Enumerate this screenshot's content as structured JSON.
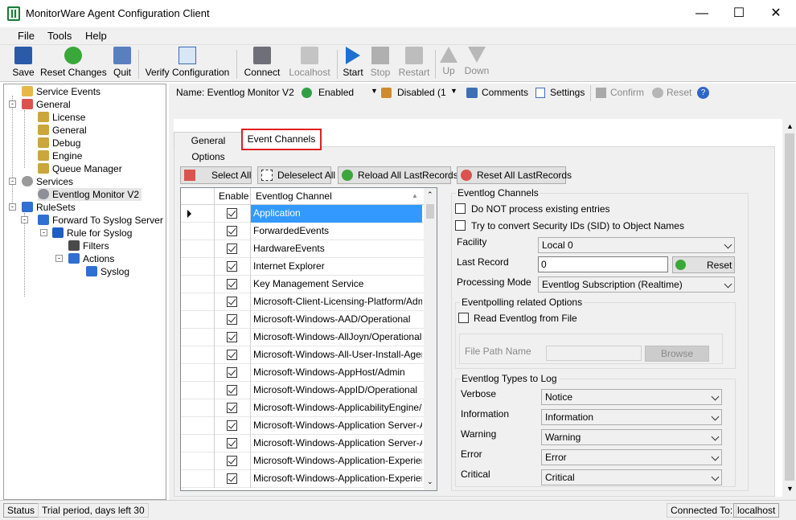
{
  "window": {
    "title": "MonitorWare Agent Configuration Client"
  },
  "menu": [
    "File",
    "Tools",
    "Help"
  ],
  "toolbar": {
    "save": "Save",
    "reset_changes": "Reset Changes",
    "quit": "Quit",
    "verify": "Verify Configuration",
    "connect": "Connect",
    "localhost": "Localhost",
    "start": "Start",
    "stop": "Stop",
    "restart": "Restart",
    "up": "Up",
    "down": "Down"
  },
  "tree": {
    "service_events": "Service Events",
    "general": "General",
    "license": "License",
    "general2": "General",
    "debug": "Debug",
    "engine": "Engine",
    "queue_manager": "Queue Manager",
    "services": "Services",
    "eventlog_monitor": "Eventlog Monitor V2",
    "rulesets": "RuleSets",
    "forward": "Forward To Syslog Server",
    "rule": "Rule for Syslog",
    "filters": "Filters",
    "actions": "Actions",
    "syslog": "Syslog"
  },
  "panel_toolbar": {
    "name": "Name: Eventlog Monitor V2",
    "enabled": "Enabled",
    "disabled": "Disabled (1",
    "comments": "Comments",
    "settings": "Settings",
    "confirm": "Confirm",
    "reset": "Reset"
  },
  "tabs": {
    "general_options": "General Options",
    "event_channels": "Event Channels"
  },
  "buttons": {
    "select_all": "Select All",
    "deselect_all": "Deleselect All",
    "reload": "Reload All LastRecords",
    "reset_all": "Reset All LastRecords"
  },
  "grid": {
    "col_enable": "Enable",
    "col_channel": "Eventlog Channel",
    "rows": [
      "Application",
      "ForwardedEvents",
      "HardwareEvents",
      "Internet Explorer",
      "Key Management Service",
      "Microsoft-Client-Licensing-Platform/Admin",
      "Microsoft-Windows-AAD/Operational",
      "Microsoft-Windows-AllJoyn/Operational",
      "Microsoft-Windows-All-User-Install-Agent/...",
      "Microsoft-Windows-AppHost/Admin",
      "Microsoft-Windows-AppID/Operational",
      "Microsoft-Windows-ApplicabilityEngine/O...",
      "Microsoft-Windows-Application Server-Ap...",
      "Microsoft-Windows-Application Server-Ap...",
      "Microsoft-Windows-Application-Experienc...",
      "Microsoft-Windows-Application-Experienc..."
    ]
  },
  "channels": {
    "group": "Eventlog Channels",
    "no_process": "Do NOT process existing entries",
    "try_convert": "Try to convert Security IDs (SID) to Object Names",
    "facility_label": "Facility",
    "facility_value": "Local 0",
    "last_record_label": "Last Record",
    "last_record_value": "0",
    "reset": "Reset",
    "mode_label": "Processing Mode",
    "mode_value": "Eventlog Subscription (Realtime)",
    "polling_group": "Eventpolling related Options",
    "read_eventlog": "Read Eventlog from File",
    "file_path": "File  Path Name",
    "browse": "Browse",
    "types_group": "Eventlog Types to Log",
    "types": [
      {
        "label": "Verbose",
        "value": "Notice"
      },
      {
        "label": "Information",
        "value": "Information"
      },
      {
        "label": "Warning",
        "value": "Warning"
      },
      {
        "label": "Error",
        "value": "Error"
      },
      {
        "label": "Critical",
        "value": "Critical"
      }
    ]
  },
  "status": {
    "status": "Status",
    "trial": "Trial period, days left 30",
    "connected": "Connected To:",
    "host": "localhost"
  }
}
